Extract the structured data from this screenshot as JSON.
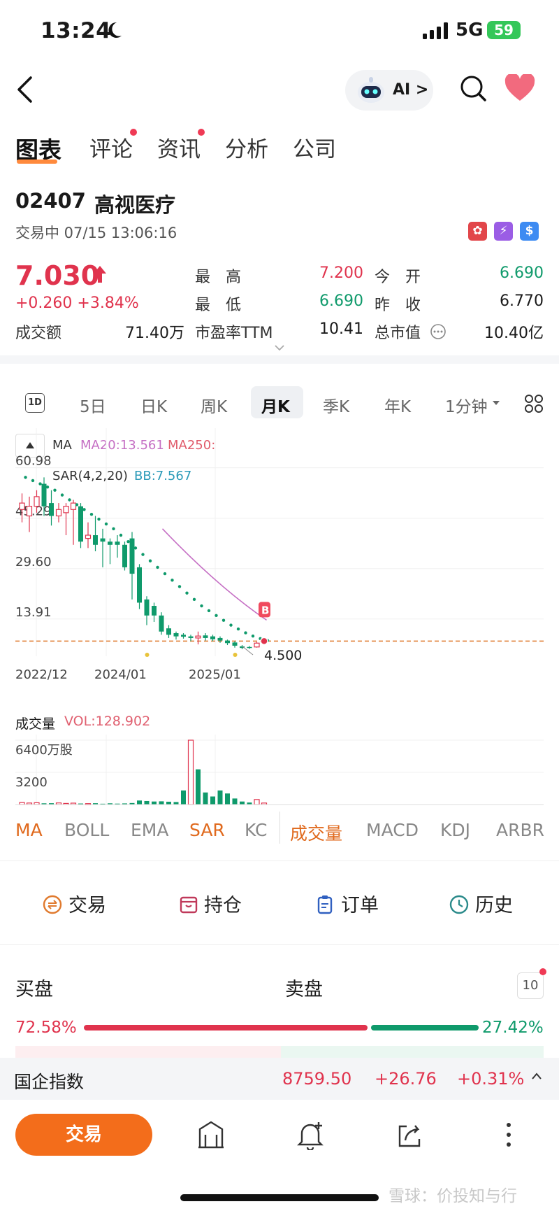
{
  "status_bar": {
    "time": "13:24",
    "network": "5G",
    "battery": "59"
  },
  "nav": {
    "ai_label": "AI >"
  },
  "tabs": [
    {
      "label": "图表",
      "active": true,
      "dot": false
    },
    {
      "label": "评论",
      "active": false,
      "dot": true
    },
    {
      "label": "资讯",
      "active": false,
      "dot": true
    },
    {
      "label": "分析",
      "active": false,
      "dot": false
    },
    {
      "label": "公司",
      "active": false,
      "dot": false
    }
  ],
  "stock": {
    "code": "02407",
    "name": "高视医疗",
    "status": "交易中 07/15 13:06:16",
    "price": "7.030",
    "change": "+0.260  +3.84%",
    "quote": {
      "high_label": "最　高",
      "high": "7.200",
      "open_label": "今　开",
      "open": "6.690",
      "low_label": "最　低",
      "low": "6.690",
      "prev_label": "昨　收",
      "prev_close": "6.770",
      "turnover_label": "成交额",
      "turnover": "71.40万",
      "pe_label": "市盈率TTM",
      "pe": "10.41",
      "mcap_label": "总市值",
      "mcap": "10.40亿"
    }
  },
  "periods": [
    "5日",
    "日K",
    "周K",
    "月K",
    "季K",
    "年K",
    "1分钟"
  ],
  "period_active": "月K",
  "chart_legend": {
    "ma": "MA",
    "ma20": "MA20:13.561",
    "ma250": "MA250:",
    "sar": "SAR(4,2,20)",
    "bb": "BB:7.567",
    "buy_marker": "B",
    "low_annotation": "4.500"
  },
  "chart_data": {
    "type": "candlestick",
    "y_ticks": [
      "60.98",
      "45.29",
      "29.60",
      "13.91"
    ],
    "x_ticks": [
      "2022/12",
      "2024/01",
      "2025/01"
    ],
    "ylim": [
      4.5,
      62
    ],
    "reference_line": 7.03,
    "candles": [
      {
        "o": 48,
        "c": 50,
        "h": 53,
        "l": 44,
        "up": true
      },
      {
        "o": 46,
        "c": 49,
        "h": 52,
        "l": 41,
        "up": true
      },
      {
        "o": 49,
        "c": 52,
        "h": 54,
        "l": 47,
        "up": true
      },
      {
        "o": 56,
        "c": 49,
        "h": 58,
        "l": 46,
        "up": false
      },
      {
        "o": 50,
        "c": 46,
        "h": 54,
        "l": 43,
        "up": false
      },
      {
        "o": 46,
        "c": 48,
        "h": 50,
        "l": 44,
        "up": true
      },
      {
        "o": 47,
        "c": 49,
        "h": 50,
        "l": 40,
        "up": true
      },
      {
        "o": 48,
        "c": 50,
        "h": 51,
        "l": 37,
        "up": true
      },
      {
        "o": 49,
        "c": 38,
        "h": 50,
        "l": 36,
        "up": false
      },
      {
        "o": 39,
        "c": 40,
        "h": 44,
        "l": 36,
        "up": true
      },
      {
        "o": 40,
        "c": 37,
        "h": 46,
        "l": 35,
        "up": false
      },
      {
        "o": 39,
        "c": 38,
        "h": 42,
        "l": 30,
        "up": false
      },
      {
        "o": 38,
        "c": 37,
        "h": 39,
        "l": 31,
        "up": false
      },
      {
        "o": 38,
        "c": 37,
        "h": 40,
        "l": 33,
        "up": false
      },
      {
        "o": 37,
        "c": 30,
        "h": 38,
        "l": 29,
        "up": false
      },
      {
        "o": 39,
        "c": 28,
        "h": 41,
        "l": 20,
        "up": false
      },
      {
        "o": 30,
        "c": 19,
        "h": 31,
        "l": 17,
        "up": false
      },
      {
        "o": 20,
        "c": 15,
        "h": 21,
        "l": 12,
        "up": false
      },
      {
        "o": 18,
        "c": 15,
        "h": 19,
        "l": 13,
        "up": false
      },
      {
        "o": 15,
        "c": 10,
        "h": 16,
        "l": 9,
        "up": false
      },
      {
        "o": 11,
        "c": 9,
        "h": 12,
        "l": 8,
        "up": false
      },
      {
        "o": 9.5,
        "c": 8.5,
        "h": 10,
        "l": 7.5,
        "up": false
      },
      {
        "o": 9,
        "c": 8.4,
        "h": 9.5,
        "l": 7.8,
        "up": false
      },
      {
        "o": 8.5,
        "c": 8,
        "h": 9,
        "l": 7,
        "up": false
      },
      {
        "o": 8,
        "c": 8.6,
        "h": 10,
        "l": 6,
        "up": true
      },
      {
        "o": 8.8,
        "c": 8,
        "h": 9.5,
        "l": 7.2,
        "up": false
      },
      {
        "o": 8.5,
        "c": 7.6,
        "h": 9,
        "l": 7,
        "up": false
      },
      {
        "o": 8,
        "c": 7.2,
        "h": 8.5,
        "l": 6.5,
        "up": false
      },
      {
        "o": 7.2,
        "c": 6.4,
        "h": 7.5,
        "l": 5.8,
        "up": false
      },
      {
        "o": 6.6,
        "c": 5.6,
        "h": 7,
        "l": 5,
        "up": false
      },
      {
        "o": 5.4,
        "c": 4.9,
        "h": 5.8,
        "l": 4.5,
        "up": false
      },
      {
        "o": 5.2,
        "c": 4.9,
        "h": 5.5,
        "l": 4.6,
        "up": false
      },
      {
        "o": 5.2,
        "c": 6.4,
        "h": 6.8,
        "l": 5,
        "up": true
      },
      {
        "o": 6.6,
        "c": 7.03,
        "h": 7.2,
        "l": 6.69,
        "up": true
      }
    ],
    "sar": [
      58,
      57,
      56,
      55,
      54,
      52.5,
      51,
      49.5,
      48,
      46.5,
      45,
      43.5,
      42,
      40,
      38,
      36,
      34,
      32,
      30,
      28,
      26,
      24,
      22,
      20,
      18,
      16.5,
      15,
      13.5,
      12,
      10.8,
      9.6,
      8.6,
      7.8,
      7.2
    ],
    "ma20_line": [
      null,
      null,
      null,
      null,
      null,
      null,
      null,
      null,
      null,
      null,
      null,
      null,
      null,
      null,
      null,
      null,
      null,
      null,
      null,
      null,
      null,
      null,
      null,
      null,
      null,
      null,
      null,
      null,
      null,
      null,
      null,
      null,
      null,
      13.561
    ],
    "ma20_start_index": 19,
    "volume": {
      "ticks": [
        "6400万股",
        "3200"
      ],
      "ylim": [
        0,
        6400
      ],
      "values": [
        200,
        150,
        180,
        120,
        130,
        160,
        110,
        140,
        100,
        90,
        130,
        80,
        120,
        90,
        110,
        150,
        400,
        350,
        300,
        320,
        280,
        250,
        1400,
        6400,
        3500,
        1200,
        800,
        1400,
        1100,
        600,
        300,
        200,
        500,
        150
      ],
      "up": [
        true,
        true,
        true,
        false,
        false,
        true,
        true,
        true,
        false,
        true,
        false,
        false,
        false,
        false,
        false,
        false,
        false,
        false,
        false,
        false,
        false,
        false,
        false,
        true,
        false,
        false,
        false,
        false,
        false,
        false,
        false,
        false,
        true,
        true
      ]
    }
  },
  "volume_legend": {
    "title": "成交量",
    "vol": "VOL:128.902"
  },
  "indicators": [
    {
      "label": "MA",
      "active": true
    },
    {
      "label": "BOLL",
      "active": false
    },
    {
      "label": "EMA",
      "active": false
    },
    {
      "label": "SAR",
      "active": true
    },
    {
      "label": "KC",
      "active": false
    },
    {
      "label": "成交量",
      "active": true
    },
    {
      "label": "MACD",
      "active": false
    },
    {
      "label": "KDJ",
      "active": false
    },
    {
      "label": "ARBR",
      "active": false
    }
  ],
  "actions": [
    {
      "label": "交易",
      "icon": "trade-icon",
      "color": "#e07a2e"
    },
    {
      "label": "持仓",
      "icon": "position-icon",
      "color": "#c0395a"
    },
    {
      "label": "订单",
      "icon": "order-icon",
      "color": "#3060c0"
    },
    {
      "label": "历史",
      "icon": "history-icon",
      "color": "#2a8a8a"
    }
  ],
  "order_book": {
    "buy_title": "买盘",
    "sell_title": "卖盘",
    "depth": "10",
    "buy_pct": "72.58%",
    "sell_pct": "27.42%",
    "buy_ratio": 0.7258
  },
  "index": {
    "name": "国企指数",
    "value": "8759.50",
    "change": "+26.76",
    "pct": "+0.31%"
  },
  "bottom": {
    "trade": "交易"
  },
  "watermark": "雪球：价投知与行"
}
